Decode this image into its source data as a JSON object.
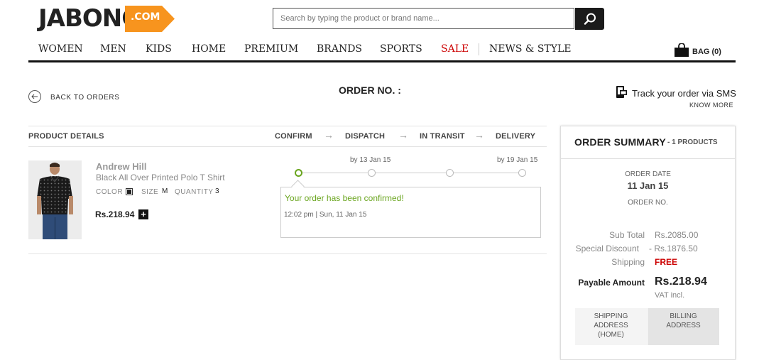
{
  "header": {
    "logo_text": "JABONG",
    "logo_badge": ".COM",
    "search_placeholder": "Search by typing the product or brand name...",
    "nav": [
      "WOMEN",
      "MEN",
      "KIDS",
      "HOME",
      "PREMIUM",
      "BRANDS",
      "SPORTS",
      "SALE",
      "NEWS & STYLE"
    ],
    "bag_label": "BAG (0)",
    "colors": {
      "accent": "#f7941e",
      "sale": "#cc0000"
    },
    "icons": {
      "search": "search-icon",
      "bag": "bag-icon"
    }
  },
  "order": {
    "back_label": "BACK TO ORDERS",
    "title": "ORDER NO. :",
    "sms_label": "Track your order via SMS",
    "know_more": "KNOW MORE"
  },
  "table": {
    "product_header": "PRODUCT DETAILS",
    "steps": [
      "CONFIRM",
      "DISPATCH",
      "IN TRANSIT",
      "DELIVERY"
    ],
    "dispatch_by": "by 13 Jan 15",
    "delivery_by": "by 19 Jan 15",
    "current_step_index": 0
  },
  "product": {
    "brand": "Andrew Hill",
    "name": "Black All Over Printed Polo T Shirt",
    "color_label": "COLOR",
    "size_label": "SIZE",
    "size_value": "M",
    "quantity_label": "QUANTITY",
    "quantity_value": "3",
    "price": "Rs.218.94",
    "status_message": "Your order has been confirmed!",
    "status_time": "12:02 pm | Sun, 11 Jan 15",
    "status_color": "#6aa51f"
  },
  "summary": {
    "title": "ORDER SUMMARY",
    "count": "- 1 PRODUCTS",
    "order_date_label": "ORDER DATE",
    "order_date": "11 Jan 15",
    "order_no_label": "ORDER NO.",
    "subtotal_label": "Sub Total",
    "subtotal": "Rs.2085.00",
    "discount_label": "Special Discount",
    "discount": "- Rs.1876.50",
    "shipping_label": "Shipping",
    "shipping": "FREE",
    "payable_label": "Payable Amount",
    "payable": "Rs.218.94",
    "vat": "VAT incl.",
    "shipping_address_lines": [
      "SHIPPING",
      "ADDRESS",
      "(HOME)"
    ],
    "billing_address_lines": [
      "BILLING",
      "ADDRESS"
    ]
  }
}
